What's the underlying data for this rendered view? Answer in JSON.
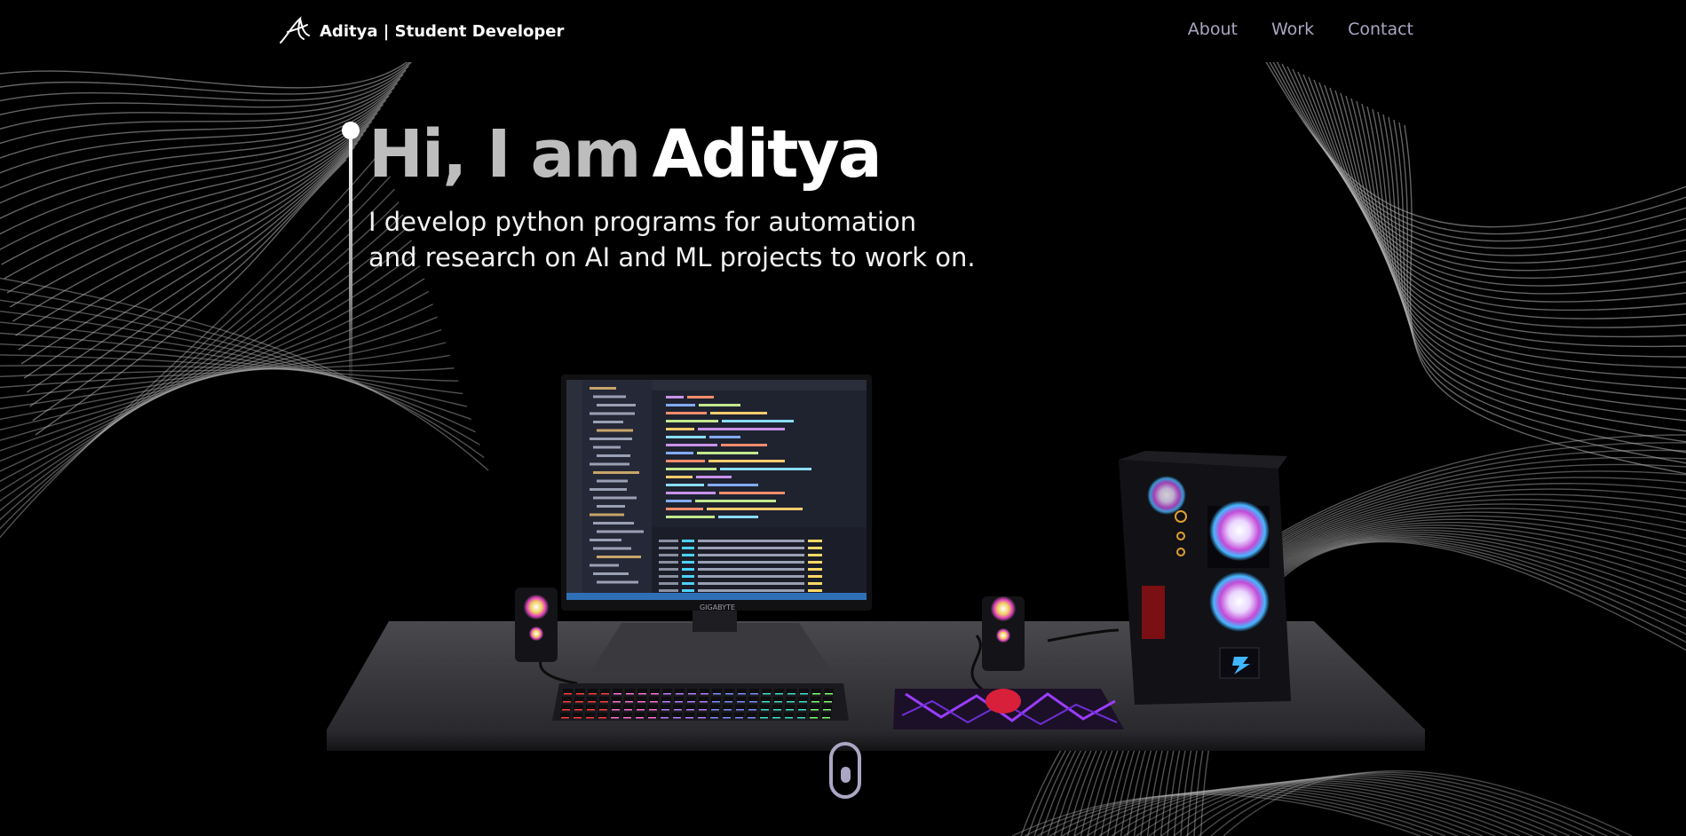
{
  "nav": {
    "brand_name": "Aditya",
    "brand_separator": "|",
    "brand_role": "Student Developer",
    "links": [
      {
        "label": "About"
      },
      {
        "label": "Work"
      },
      {
        "label": "Contact"
      }
    ],
    "link_color": "#aaa6c3"
  },
  "hero": {
    "greeting": "Hi, I am",
    "name": "Aditya",
    "subtitle_line1": "I develop python programs for automation",
    "subtitle_line2": "and research on AI and ML projects to work on."
  },
  "scene": {
    "monitor_brand": "GIGABYTE"
  },
  "colors": {
    "background": "#000000",
    "accent": "#aaa6c3",
    "text": "#ffffff"
  },
  "icons": {
    "logo": "signature-logo-icon",
    "scroll": "mouse-scroll-icon"
  }
}
